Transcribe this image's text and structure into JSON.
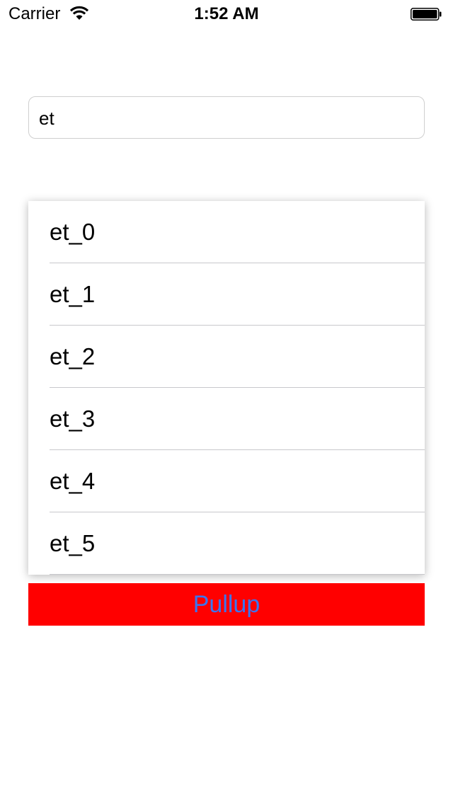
{
  "status_bar": {
    "carrier": "Carrier",
    "time": "1:52 AM",
    "icons": [
      "wifi-icon",
      "battery-icon"
    ]
  },
  "search": {
    "value": "et"
  },
  "dropdown": {
    "items": [
      {
        "label": "et_0"
      },
      {
        "label": "et_1"
      },
      {
        "label": "et_2"
      },
      {
        "label": "et_3"
      },
      {
        "label": "et_4"
      },
      {
        "label": "et_5"
      }
    ]
  },
  "pullup_button": {
    "label": "Pullup"
  },
  "colors": {
    "button_background": "#ff0000",
    "button_text": "#3a75f0",
    "separator": "#c8c8cc",
    "field_border": "#cfcfcf"
  }
}
